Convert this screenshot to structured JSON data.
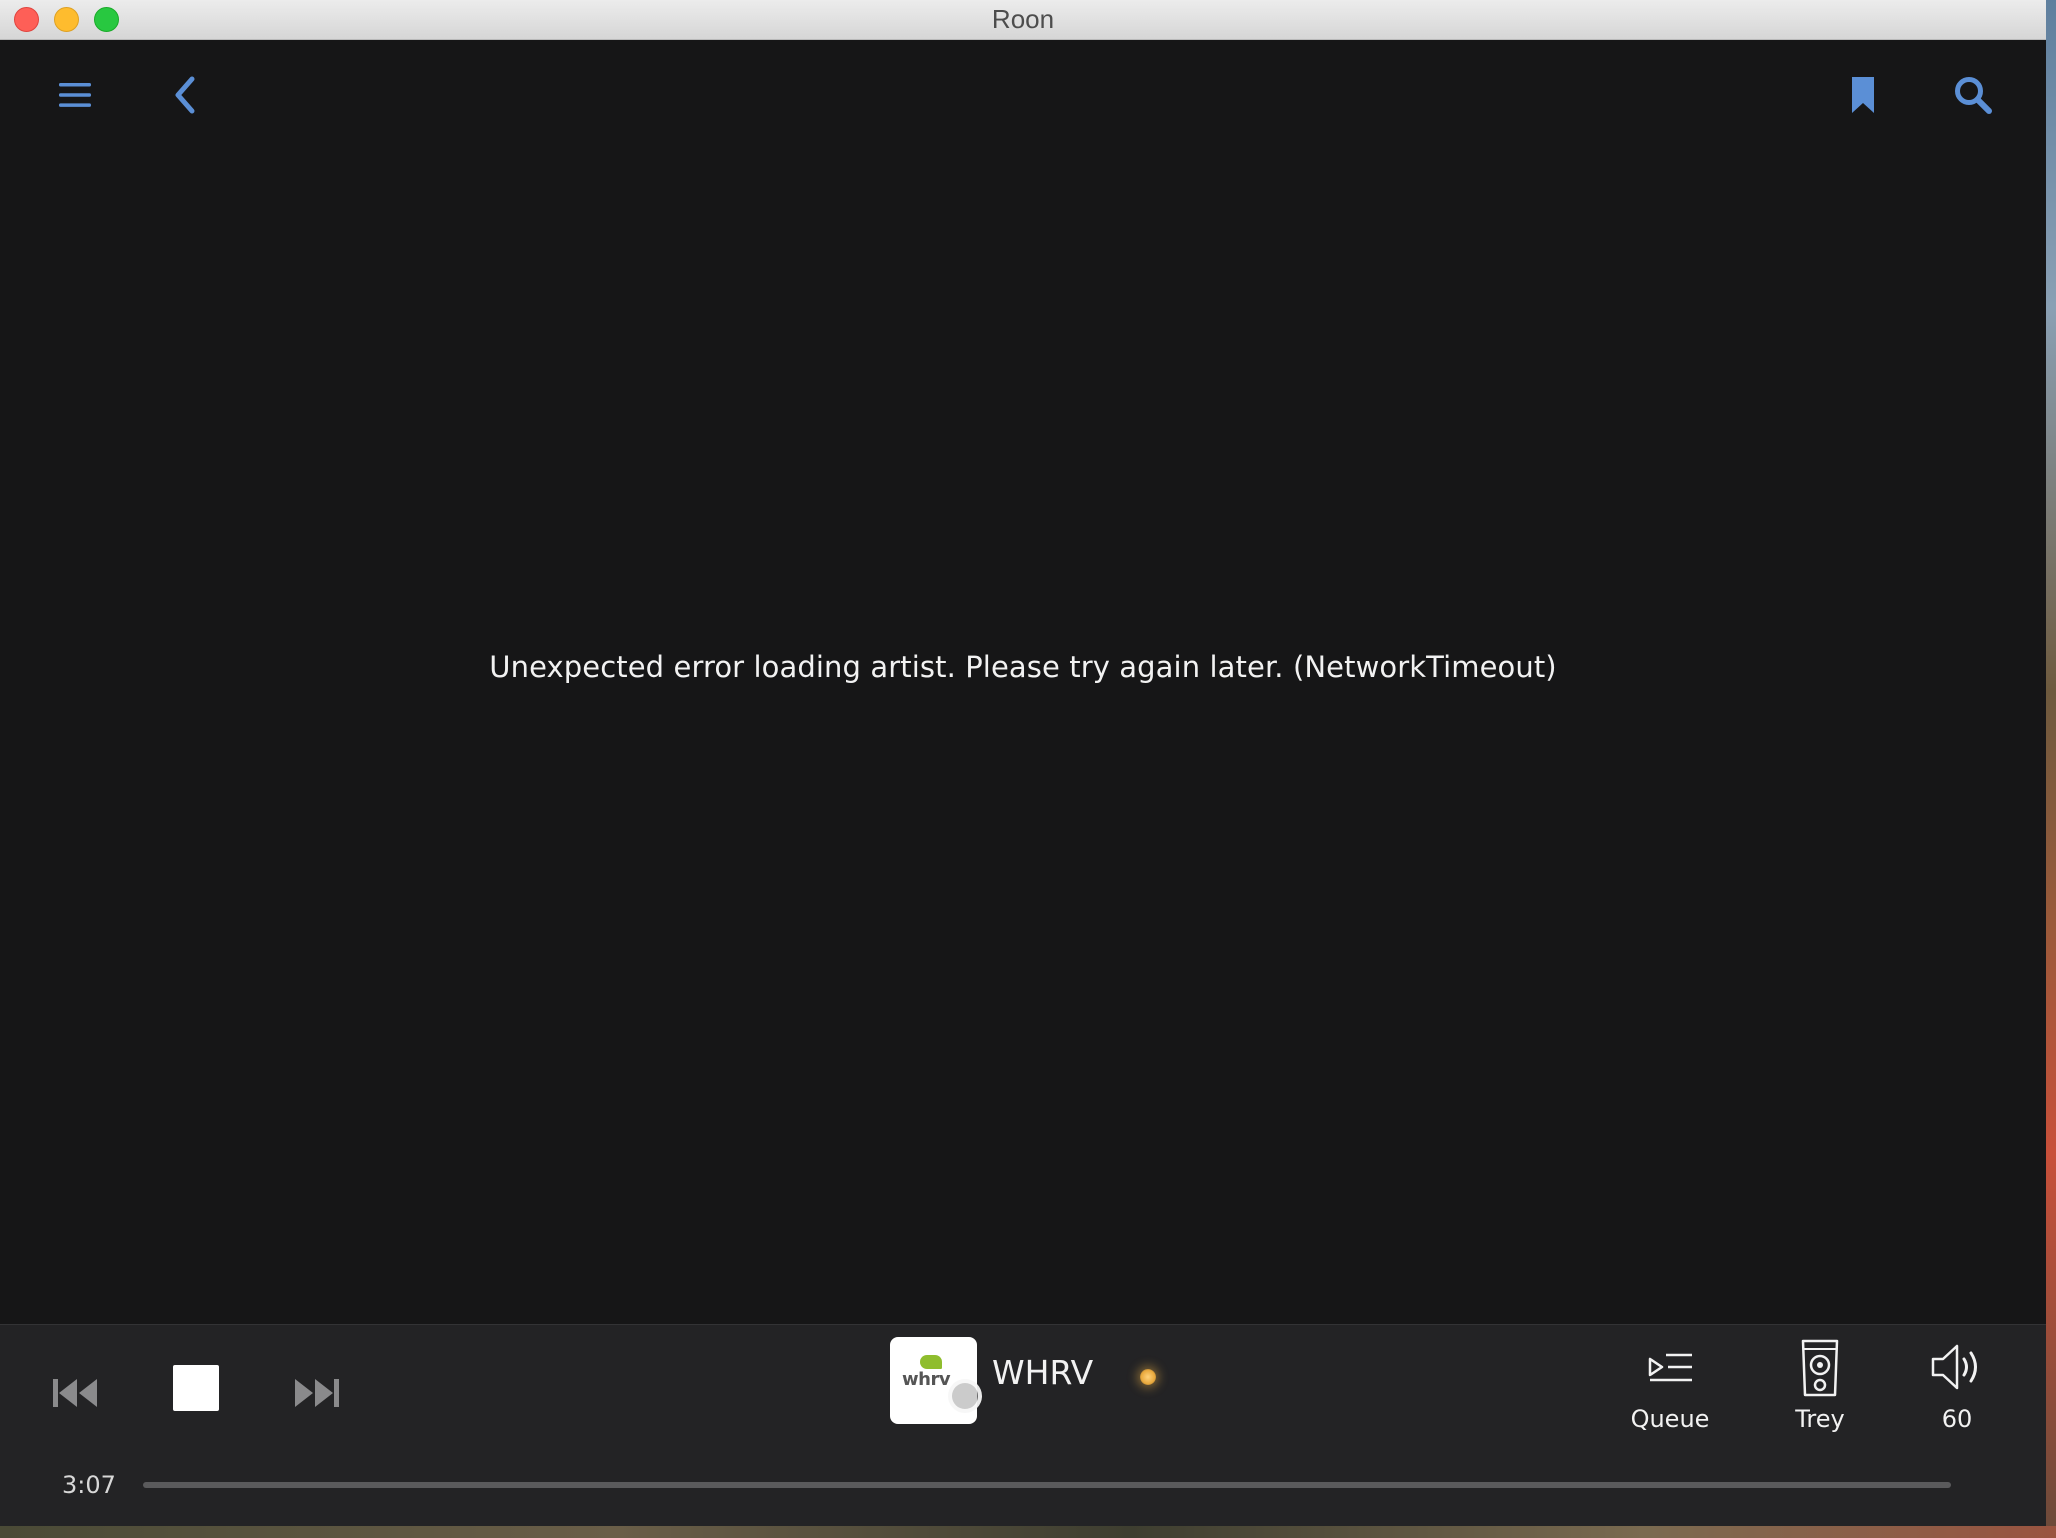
{
  "window": {
    "title": "Roon"
  },
  "toolbar": {
    "menu_icon": "hamburger-menu-icon",
    "back_icon": "chevron-left-icon",
    "bookmark_icon": "bookmark-icon",
    "search_icon": "search-icon",
    "accent_color": "#5b8fd6"
  },
  "main": {
    "error_message": "Unexpected error loading artist. Please try again later. (NetworkTimeout)"
  },
  "player": {
    "prev_icon": "skip-previous-icon",
    "stop_icon": "stop-icon",
    "next_icon": "skip-next-icon",
    "album_art_text": "whrv",
    "station_name": "WHRV",
    "queue_label": "Queue",
    "zone_label": "Trey",
    "volume_value": "60",
    "elapsed_time": "3:07"
  }
}
